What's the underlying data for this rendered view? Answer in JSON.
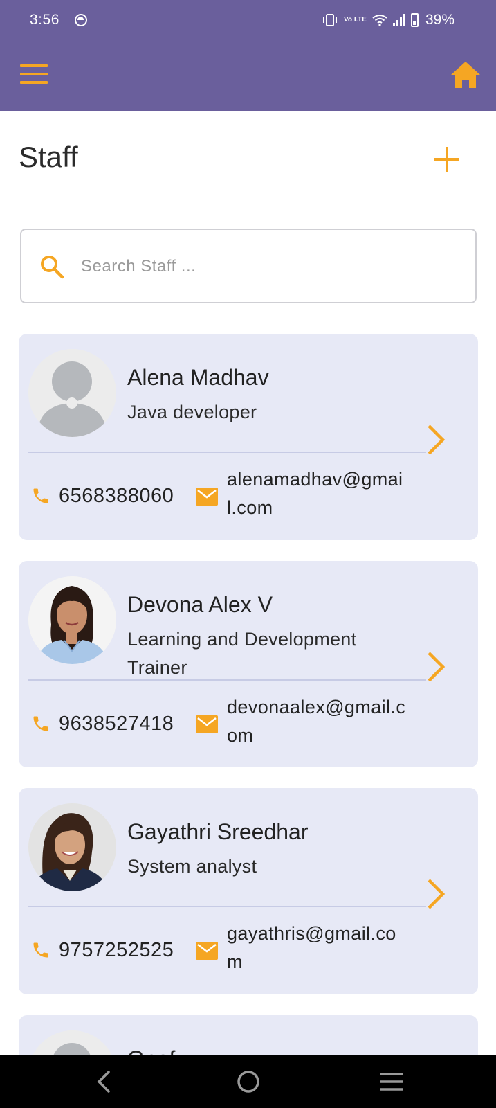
{
  "status_bar": {
    "time": "3:56",
    "battery_percent": "39%",
    "network_label": "Vo LTE"
  },
  "toolbar": {
    "menu_icon": "hamburger-menu-icon",
    "home_icon": "home-icon"
  },
  "header": {
    "title": "Staff",
    "add_icon": "plus-icon"
  },
  "search": {
    "placeholder": "Search Staff ...",
    "value": ""
  },
  "staff": [
    {
      "name": "Alena Madhav",
      "role": "Java developer",
      "phone": "6568388060",
      "email": "alenamadhav@gmail.com",
      "avatar": "placeholder"
    },
    {
      "name": "Devona Alex V",
      "role": "Learning and Development Trainer",
      "phone": "9638527418",
      "email": "devonaalex@gmail.com",
      "avatar": "photo"
    },
    {
      "name": "Gayathri Sreedhar",
      "role": "System analyst",
      "phone": "9757252525",
      "email": "gayathris@gmail.com",
      "avatar": "photo"
    },
    {
      "name": "Gnefy",
      "role": "",
      "phone": "",
      "email": "",
      "avatar": "placeholder"
    }
  ],
  "colors": {
    "appbar": "#6a5f9c",
    "accent": "#f5a623",
    "card": "#e7e9f6",
    "navbar": "#000000"
  },
  "navbar": {
    "back_icon": "back-icon",
    "home_icon": "circle-home-icon",
    "recents_icon": "recents-icon"
  }
}
